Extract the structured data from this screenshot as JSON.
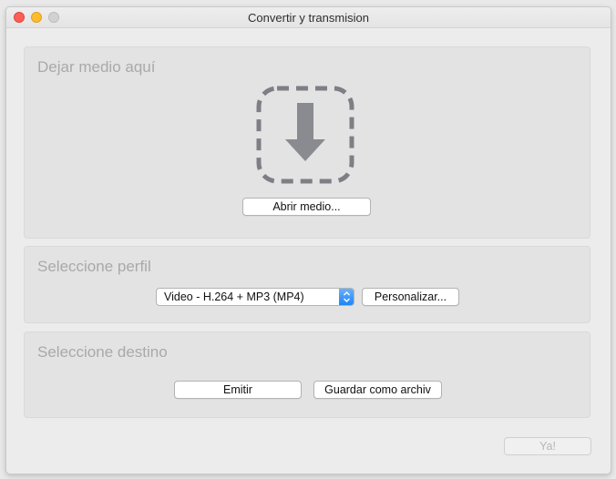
{
  "window": {
    "title": "Convertir y transmision"
  },
  "drop_panel": {
    "title": "Dejar medio aquí",
    "drop_icon": "download-arrow-icon",
    "open_button": "Abrir medio..."
  },
  "profile_panel": {
    "title": "Seleccione perfil",
    "selected_profile": "Video - H.264 + MP3 (MP4)",
    "customize_button": "Personalizar..."
  },
  "destination_panel": {
    "title": "Seleccione destino",
    "stream_button": "Emitir",
    "save_button": "Guardar como archiv"
  },
  "footer": {
    "go_button": "Ya!"
  },
  "colors": {
    "accent": "#1a82f6",
    "close": "#fc5f57",
    "minimize": "#fdbc2e"
  }
}
